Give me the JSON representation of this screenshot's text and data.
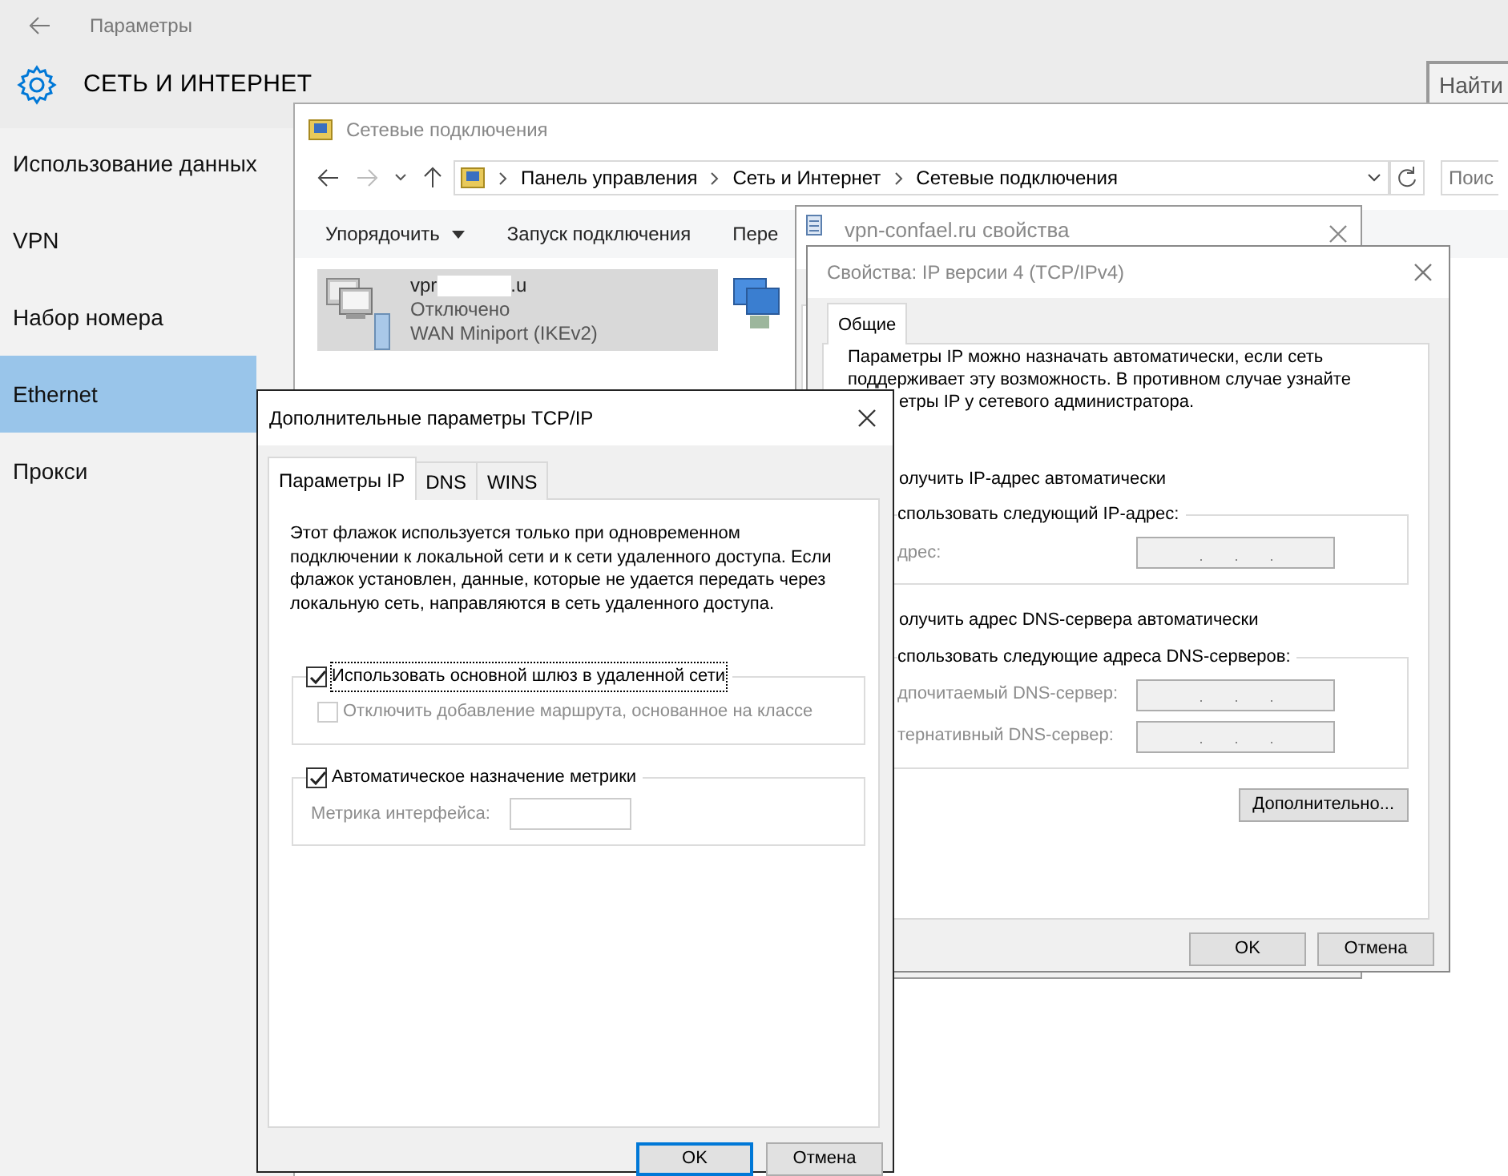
{
  "settings": {
    "title": "Параметры",
    "section": "СЕТЬ И ИНТЕРНЕТ",
    "search_button": "Найти",
    "sidebar": [
      {
        "label": "Использование данных",
        "selected": false
      },
      {
        "label": "VPN",
        "selected": false
      },
      {
        "label": "Набор номера",
        "selected": false
      },
      {
        "label": "Ethernet",
        "selected": true
      },
      {
        "label": "Прокси",
        "selected": false
      }
    ]
  },
  "explorer": {
    "title": "Сетевые подключения",
    "breadcrumb": [
      "Панель управления",
      "Сеть и Интернет",
      "Сетевые подключения"
    ],
    "search_placeholder": "Поис",
    "toolbar": [
      {
        "label": "Упорядочить",
        "dropdown": true
      },
      {
        "label": "Запуск подключения",
        "dropdown": false
      },
      {
        "label": "Пере",
        "dropdown": false
      }
    ],
    "connections": [
      {
        "name_start": "vpr",
        "name_end": ".u",
        "status": "Отключено",
        "device": "WAN Miniport (IKEv2)",
        "selected": true
      }
    ]
  },
  "properties_window": {
    "title": "vpn-confael.ru свойства"
  },
  "ipv4_dialog": {
    "title": "Свойства: IP версии 4 (TCP/IPv4)",
    "tabs": [
      {
        "label": "Общие",
        "selected": true
      }
    ],
    "intro_lines": [
      "Параметры IP можно назначать автоматически, если сеть",
      "поддерживает эту возможность. В противном случае узнайте",
      "етры IP у сетевого администратора."
    ],
    "auto_ip": "олучить IP-адрес автоматически",
    "manual_ip": "спользовать следующий IP-адрес:",
    "ip_fields": [
      {
        "label": "дрес:"
      }
    ],
    "auto_dns": "олучить адрес DNS-сервера автоматически",
    "manual_dns": "спользовать следующие адреса DNS-серверов:",
    "dns_fields": [
      {
        "label": "дпочитаемый DNS-сервер:"
      },
      {
        "label": "тернативный DNS-сервер:"
      }
    ],
    "advanced_button": "Дополнительно...",
    "buttons": [
      "OK",
      "Отмена"
    ]
  },
  "tcpip_dialog": {
    "title": "Дополнительные параметры TCP/IP",
    "tabs": [
      {
        "label": "Параметры IP",
        "selected": true
      },
      {
        "label": "DNS",
        "selected": false
      },
      {
        "label": "WINS",
        "selected": false
      }
    ],
    "description_lines": [
      "Этот флажок используется только при одновременном",
      "подключении к локальной сети и к сети удаленного доступа. Если",
      "флажок установлен, данные, которые не удается передать через",
      "локальную сеть, направляются в сеть удаленного доступа."
    ],
    "gateway": {
      "label": "Использовать основной шлюз в удаленной сети",
      "checked": true,
      "focused": true
    },
    "class_route": {
      "label": "Отключить добавление маршрута, основанное на классе",
      "checked": false,
      "disabled": true
    },
    "auto_metric": {
      "label": "Автоматическое назначение метрики",
      "checked": true
    },
    "metric_field": {
      "label": "Метрика интерфейса:",
      "disabled": true
    },
    "buttons": [
      {
        "label": "OK",
        "default": true
      },
      {
        "label": "Отмена",
        "default": false
      }
    ]
  }
}
